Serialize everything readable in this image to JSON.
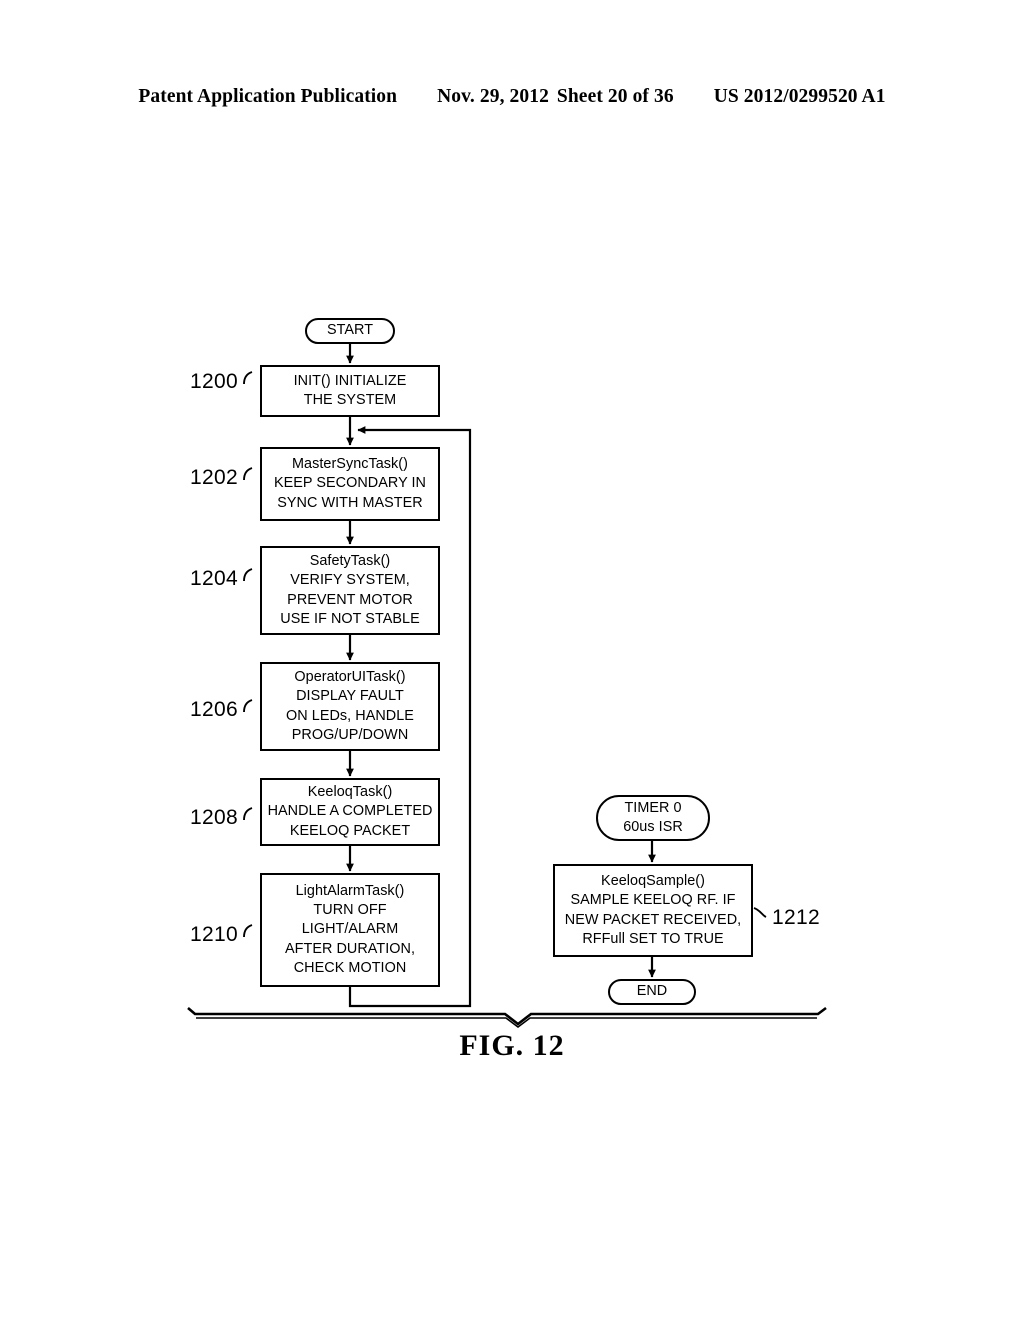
{
  "header": {
    "publication": "Patent Application Publication",
    "date": "Nov. 29, 2012",
    "sheet": "Sheet 20 of 36",
    "number": "US 2012/0299520 A1"
  },
  "figure": {
    "caption": "FIG. 12",
    "nodes": {
      "start": {
        "label": "START",
        "shape": "terminal"
      },
      "init": {
        "ref": "1200",
        "lines": [
          "INIT() INITIALIZE",
          "THE SYSTEM"
        ]
      },
      "master_sync": {
        "ref": "1202",
        "lines": [
          "MasterSyncTask()",
          "KEEP SECONDARY IN",
          "SYNC WITH MASTER"
        ]
      },
      "safety": {
        "ref": "1204",
        "lines": [
          "SafetyTask()",
          "VERIFY SYSTEM,",
          "PREVENT MOTOR",
          "USE IF NOT STABLE"
        ]
      },
      "operator_ui": {
        "ref": "1206",
        "lines": [
          "OperatorUITask()",
          "DISPLAY FAULT",
          "ON LEDs, HANDLE",
          "PROG/UP/DOWN"
        ]
      },
      "keeloq_task": {
        "ref": "1208",
        "lines": [
          "KeeloqTask()",
          "HANDLE A COMPLETED",
          "KEELOQ PACKET"
        ]
      },
      "light_alarm": {
        "ref": "1210",
        "lines": [
          "LightAlarmTask()",
          "TURN OFF",
          "LIGHT/ALARM",
          "AFTER DURATION,",
          "CHECK MOTION"
        ]
      },
      "timer_isr": {
        "shape": "terminal",
        "lines": [
          "TIMER 0",
          "60us ISR"
        ]
      },
      "keeloq_sample": {
        "ref": "1212",
        "lines": [
          "KeeloqSample()",
          "SAMPLE KEELOQ RF.  IF",
          "NEW PACKET RECEIVED,",
          "RFFull SET TO TRUE"
        ]
      },
      "end": {
        "label": "END",
        "shape": "terminal"
      }
    }
  },
  "colors": {
    "ink": "#000000",
    "paper": "#ffffff"
  }
}
